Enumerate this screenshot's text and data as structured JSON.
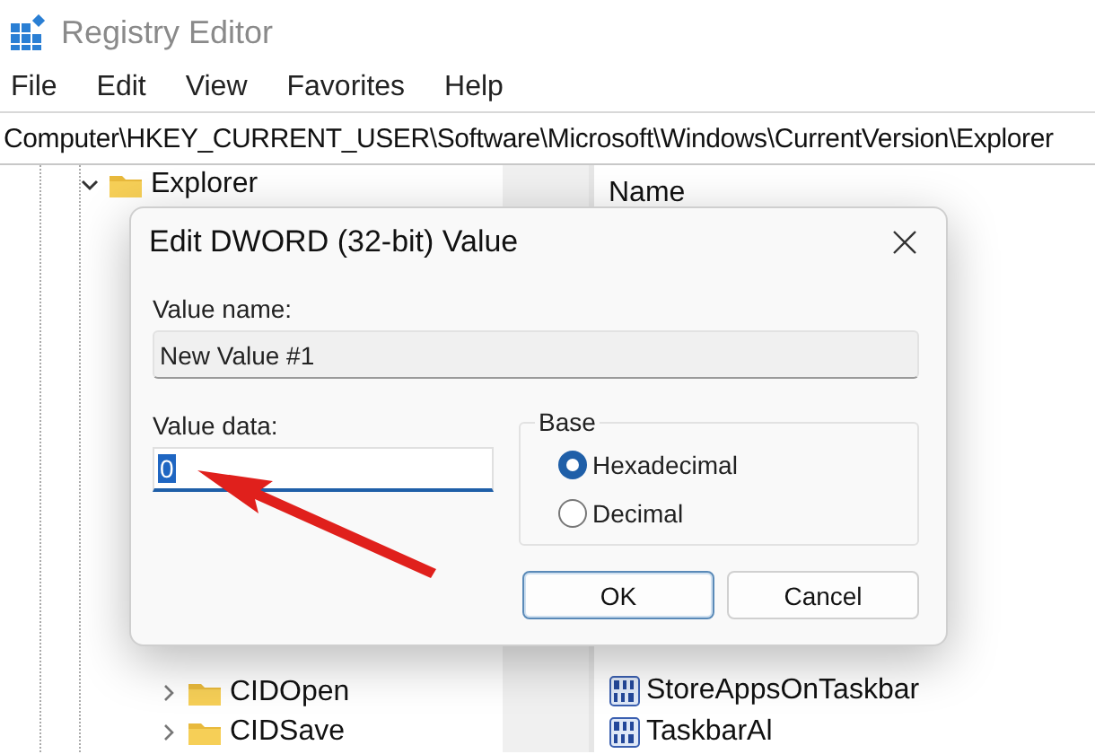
{
  "window": {
    "title": "Registry Editor"
  },
  "menu": [
    "File",
    "Edit",
    "View",
    "Favorites",
    "Help"
  ],
  "address_bar": {
    "path": "Computer\\HKEY_CURRENT_USER\\Software\\Microsoft\\Windows\\CurrentVersion\\Explorer"
  },
  "tree": {
    "items": [
      {
        "label": "Explorer",
        "expanded": true,
        "children": [
          {
            "label": "CIDOpen",
            "expanded": false
          },
          {
            "label": "CIDSave",
            "expanded": false
          }
        ]
      }
    ]
  },
  "values_list": {
    "columns": [
      "Name"
    ],
    "items": [
      {
        "name": "StoreAppsOnTaskbar"
      },
      {
        "name": "TaskbarAl"
      }
    ]
  },
  "dialog": {
    "title": "Edit DWORD (32-bit) Value",
    "value_name_label": "Value name:",
    "value_name": "New Value #1",
    "value_data_label": "Value data:",
    "value_data": "0",
    "base_label": "Base",
    "bases": [
      {
        "label": "Hexadecimal",
        "selected": true
      },
      {
        "label": "Decimal",
        "selected": false
      }
    ],
    "buttons": [
      {
        "label": "OK",
        "default": true
      },
      {
        "label": "Cancel",
        "default": false
      }
    ]
  }
}
